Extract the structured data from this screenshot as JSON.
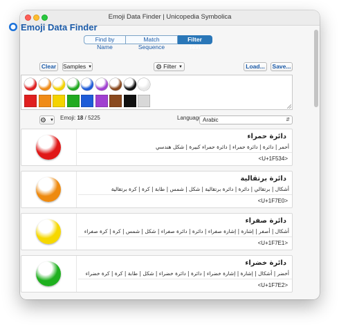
{
  "window": {
    "title": "Emoji Data Finder | Unicopedia Symbolica"
  },
  "app": {
    "title": "Emoji Data Finder"
  },
  "tabs": [
    {
      "label": "Find by Name",
      "active": false
    },
    {
      "label": "Match Sequence",
      "active": false
    },
    {
      "label": "Filter Text",
      "active": true
    }
  ],
  "toolbar": {
    "clear_label": "Clear",
    "samples_label": "Samples",
    "filter_label": "Filter",
    "load_label": "Load...",
    "save_label": "Save..."
  },
  "swatches": {
    "circle_colors": [
      "#e02020",
      "#f08c18",
      "#f4d300",
      "#22aa22",
      "#1e5cd8",
      "#a040d0",
      "#8a4a20",
      "#111111",
      "#e8e8e8"
    ],
    "square_colors": [
      "#e02020",
      "#f08c18",
      "#f4d300",
      "#22aa22",
      "#1e5cd8",
      "#a040d0",
      "#8a4a20",
      "#111111",
      "#d8d8d8"
    ]
  },
  "status": {
    "emoji_label": "Emoji:",
    "count_shown": "18",
    "count_separator": "/",
    "count_total": "5225",
    "language_label": "Language:",
    "language_value": "Arabic"
  },
  "results": [
    {
      "name": "دائرة حمراء",
      "tags": "أحمر | دائرة | دائرة حمراء | دائرة حمراء كبيرة | شكل هندسي",
      "code": "<U+1F534>",
      "color": "#e01818"
    },
    {
      "name": "دائرة برتقالية",
      "tags": "أشكال | برتقالي | دائرة | دائرة برتقالية | شكل | شمس | طابة | كرة | كرة برتقالية",
      "code": "<U+1F7E0>",
      "color": "#ee8a10"
    },
    {
      "name": "دائرة صفراء",
      "tags": "أشكال | أصفر | إشارة | إشارة صفراء | دائرة | دائرة صفراء | شكل | شمس | كرة | كرة صفراء",
      "code": "<U+1F7E1>",
      "color": "#f6d800"
    },
    {
      "name": "دائرة خضراء",
      "tags": "أخضر | أشكال | إشارة | إشارة خضراء | دائرة | دائرة خضراء | شكل | طابة | كرة | كرة خضراء",
      "code": "<U+1F7E2>",
      "color": "#1fb01f"
    }
  ]
}
